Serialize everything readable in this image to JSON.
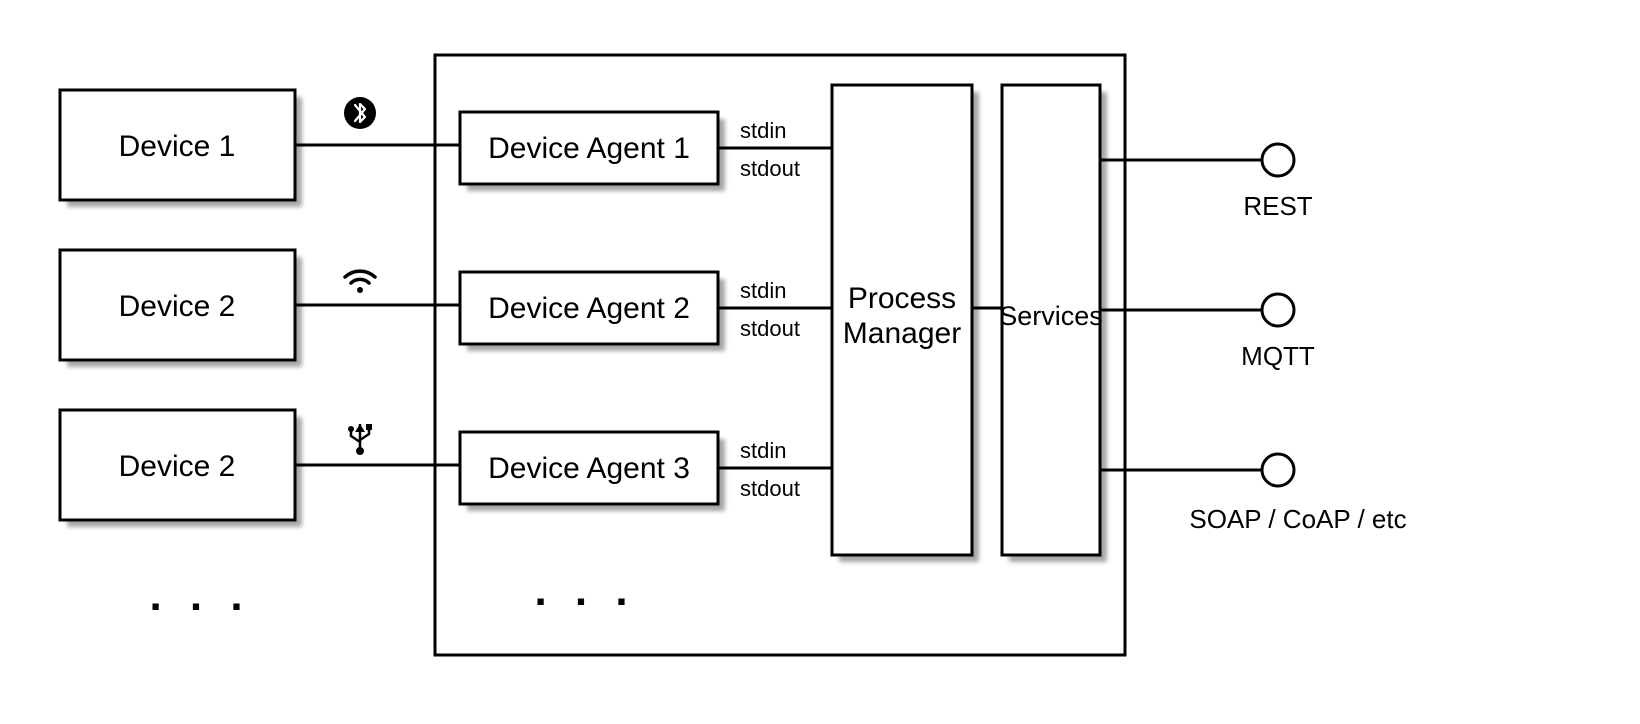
{
  "devices": [
    {
      "label": "Device 1"
    },
    {
      "label": "Device 2"
    },
    {
      "label": "Device 2"
    }
  ],
  "connections": [
    {
      "icon": "bluetooth"
    },
    {
      "icon": "wifi"
    },
    {
      "icon": "usb"
    }
  ],
  "agents": [
    {
      "label": "Device Agent 1",
      "io_top": "stdin",
      "io_bottom": "stdout"
    },
    {
      "label": "Device Agent 2",
      "io_top": "stdin",
      "io_bottom": "stdout"
    },
    {
      "label": "Device Agent 3",
      "io_top": "stdin",
      "io_bottom": "stdout"
    }
  ],
  "process_manager": {
    "line1": "Process",
    "line2": "Manager"
  },
  "services": {
    "label": "Services"
  },
  "protocols": [
    {
      "label": "REST"
    },
    {
      "label": "MQTT"
    },
    {
      "label": "SOAP / CoAP / etc"
    }
  ],
  "ellipsis": "..."
}
